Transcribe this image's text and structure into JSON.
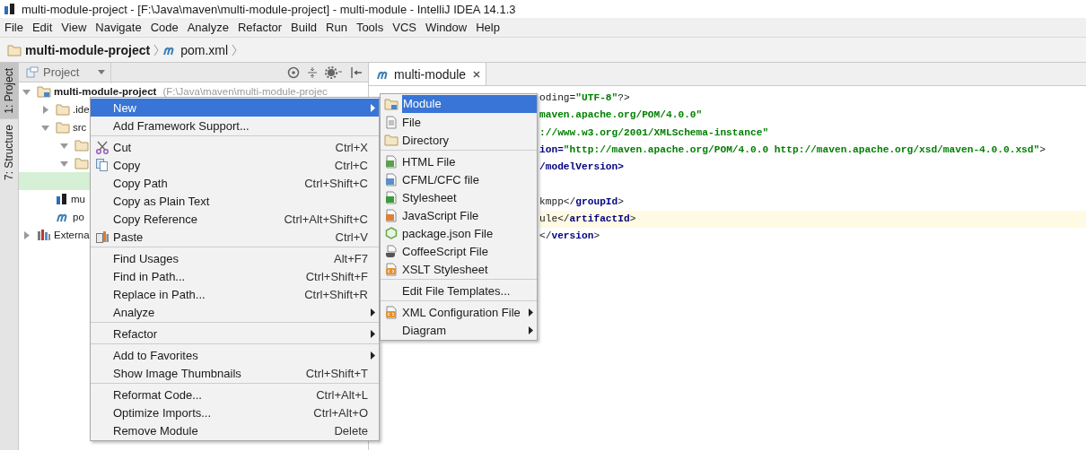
{
  "window": {
    "title": "multi-module-project - [F:\\Java\\maven\\multi-module-project] - multi-module - IntelliJ IDEA 14.1.3"
  },
  "menu_bar": [
    "File",
    "Edit",
    "View",
    "Navigate",
    "Code",
    "Analyze",
    "Refactor",
    "Build",
    "Run",
    "Tools",
    "VCS",
    "Window",
    "Help"
  ],
  "breadcrumb": [
    "multi-module-project",
    "pom.xml"
  ],
  "side_tabs": [
    {
      "label": "1: Project",
      "selected": true
    },
    {
      "label": "7: Structure",
      "selected": false
    }
  ],
  "project_panel": {
    "view": "Project",
    "tree": [
      {
        "label": "multi-module-project",
        "path": "(F:\\Java\\maven\\multi-module-projec",
        "kind": "module",
        "expanded": true,
        "selected": false,
        "children": [
          {
            "label": ".ide",
            "kind": "folder",
            "expanded": false,
            "selected": false
          },
          {
            "label": "src",
            "kind": "folder",
            "expanded": true,
            "selected": false,
            "children": [
              {
                "kind": "folder",
                "expanded": true,
                "selected": false
              },
              {
                "kind": "folder",
                "expanded": true,
                "selected": false,
                "children": [
                  {
                    "selected": true
                  }
                ]
              }
            ]
          },
          {
            "label": "mu",
            "kind": "iml",
            "selected": false
          },
          {
            "label": "po",
            "kind": "pom",
            "selected": false
          }
        ]
      },
      {
        "label": "Externa",
        "kind": "libraries",
        "expanded": false,
        "selected": false
      }
    ]
  },
  "editor": {
    "tabs": [
      {
        "label": "multi-module",
        "selected": true
      }
    ],
    "lines": [
      {
        "current": false,
        "segments": [
          {
            "kind": "text",
            "text": "oding="
          },
          {
            "kind": "value",
            "text": "\"UTF-8\""
          },
          {
            "kind": "text",
            "text": "?>"
          }
        ]
      },
      {
        "current": false,
        "segments": [
          {
            "kind": "value",
            "text": "maven.apache.org/POM/4.0.0\""
          }
        ]
      },
      {
        "current": false,
        "segments": [
          {
            "kind": "value",
            "text": "://www.w3.org/2001/XMLSchema-instance\""
          }
        ]
      },
      {
        "current": false,
        "segments": [
          {
            "kind": "tag",
            "text": "ion="
          },
          {
            "kind": "value",
            "text": "\"http://maven.apache.org/POM/4.0.0 http://maven.apache.org/xsd/maven-4.0.0.xsd\""
          },
          {
            "kind": "text",
            "text": ">"
          }
        ]
      },
      {
        "current": false,
        "segments": [
          {
            "kind": "tag",
            "text": "/modelVersion>"
          }
        ]
      },
      {
        "current": false
      },
      {
        "current": false,
        "segments": [
          {
            "kind": "text",
            "text": "kmpp</"
          },
          {
            "kind": "tag",
            "text": "groupId"
          },
          {
            "kind": "text",
            "text": ">"
          }
        ]
      },
      {
        "current": true,
        "segments": [
          {
            "kind": "text",
            "text": "ule</"
          },
          {
            "kind": "tag",
            "text": "artifactId"
          },
          {
            "kind": "text",
            "text": ">"
          }
        ]
      },
      {
        "current": false,
        "segments": [
          {
            "kind": "text",
            "text": "</"
          },
          {
            "kind": "tag",
            "text": "version"
          },
          {
            "kind": "text",
            "text": ">"
          }
        ]
      }
    ]
  },
  "context_menu": {
    "items": [
      {
        "kind": "item",
        "label": "New",
        "submenu": true,
        "selected": true
      },
      {
        "kind": "item",
        "label": "Add Framework Support...",
        "submenu": false,
        "selected": false
      },
      {
        "kind": "separator"
      },
      {
        "kind": "item",
        "label": "Cut",
        "shortcut": "Ctrl+X",
        "submenu": false,
        "selected": false
      },
      {
        "kind": "item",
        "label": "Copy",
        "shortcut": "Ctrl+C",
        "submenu": false,
        "selected": false
      },
      {
        "kind": "item",
        "label": "Copy Path",
        "shortcut": "Ctrl+Shift+C",
        "submenu": false,
        "selected": false
      },
      {
        "kind": "item",
        "label": "Copy as Plain Text",
        "submenu": false,
        "selected": false
      },
      {
        "kind": "item",
        "label": "Copy Reference",
        "shortcut": "Ctrl+Alt+Shift+C",
        "submenu": false,
        "selected": false
      },
      {
        "kind": "item",
        "label": "Paste",
        "shortcut": "Ctrl+V",
        "submenu": false,
        "selected": false
      },
      {
        "kind": "separator"
      },
      {
        "kind": "item",
        "label": "Find Usages",
        "shortcut": "Alt+F7",
        "submenu": false,
        "selected": false
      },
      {
        "kind": "item",
        "label": "Find in Path...",
        "shortcut": "Ctrl+Shift+F",
        "submenu": false,
        "selected": false
      },
      {
        "kind": "item",
        "label": "Replace in Path...",
        "shortcut": "Ctrl+Shift+R",
        "submenu": false,
        "selected": false
      },
      {
        "kind": "item",
        "label": "Analyze",
        "submenu": true,
        "selected": false
      },
      {
        "kind": "separator"
      },
      {
        "kind": "item",
        "label": "Refactor",
        "submenu": true,
        "selected": false
      },
      {
        "kind": "separator"
      },
      {
        "kind": "item",
        "label": "Add to Favorites",
        "submenu": true,
        "selected": false
      },
      {
        "kind": "item",
        "label": "Show Image Thumbnails",
        "shortcut": "Ctrl+Shift+T",
        "submenu": false,
        "selected": false
      },
      {
        "kind": "separator"
      },
      {
        "kind": "item",
        "label": "Reformat Code...",
        "shortcut": "Ctrl+Alt+L",
        "submenu": false,
        "selected": false
      },
      {
        "kind": "item",
        "label": "Optimize Imports...",
        "shortcut": "Ctrl+Alt+O",
        "submenu": false,
        "selected": false
      },
      {
        "kind": "item",
        "label": "Remove Module",
        "shortcut": "Delete",
        "submenu": false,
        "selected": false
      }
    ]
  },
  "submenu": {
    "items": [
      {
        "kind": "item",
        "label": "Module",
        "submenu": false,
        "selected": true
      },
      {
        "kind": "item",
        "label": "File",
        "submenu": false,
        "selected": false
      },
      {
        "kind": "item",
        "label": "Directory",
        "submenu": false,
        "selected": false
      },
      {
        "kind": "separator"
      },
      {
        "kind": "item",
        "label": "HTML File",
        "submenu": false,
        "selected": false
      },
      {
        "kind": "item",
        "label": "CFML/CFC file",
        "submenu": false,
        "selected": false
      },
      {
        "kind": "item",
        "label": "Stylesheet",
        "submenu": false,
        "selected": false
      },
      {
        "kind": "item",
        "label": "JavaScript File",
        "submenu": false,
        "selected": false
      },
      {
        "kind": "item",
        "label": "package.json File",
        "submenu": false,
        "selected": false
      },
      {
        "kind": "item",
        "label": "CoffeeScript File",
        "submenu": false,
        "selected": false
      },
      {
        "kind": "item",
        "label": "XSLT Stylesheet",
        "submenu": false,
        "selected": false
      },
      {
        "kind": "separator"
      },
      {
        "kind": "item",
        "label": "Edit File Templates...",
        "submenu": false,
        "selected": false
      },
      {
        "kind": "separator"
      },
      {
        "kind": "item",
        "label": "XML Configuration File",
        "submenu": true,
        "selected": false
      },
      {
        "kind": "item",
        "label": "Diagram",
        "submenu": true,
        "selected": false
      }
    ]
  }
}
